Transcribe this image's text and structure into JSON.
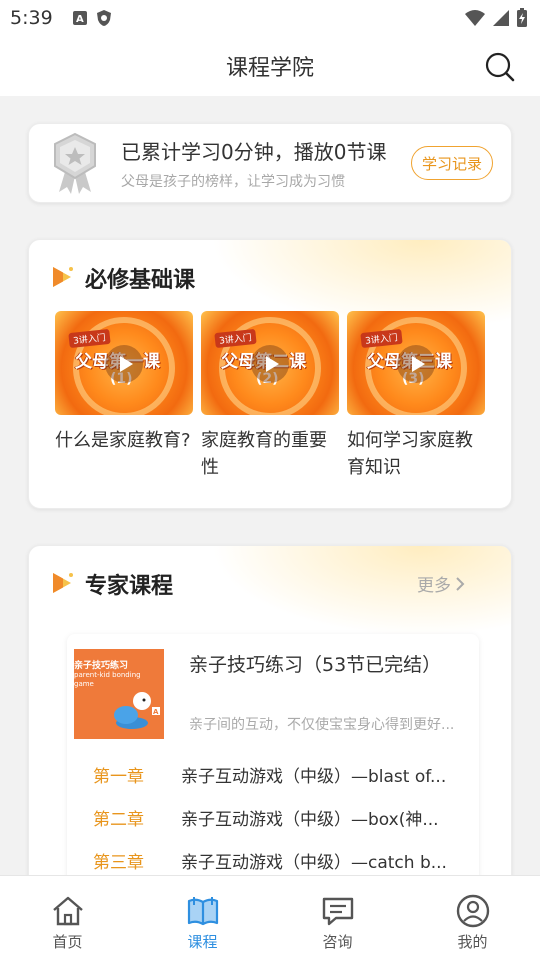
{
  "status_bar": {
    "time": "5:39"
  },
  "header": {
    "title": "课程学院"
  },
  "stats": {
    "main": "已累计学习0分钟，播放0节课",
    "sub": "父母是孩子的榜样，让学习成为习惯",
    "record_button": "学习记录"
  },
  "required": {
    "title": "必修基础课",
    "courses": [
      {
        "tag": "3讲入门",
        "thumb_title": "父母第一课",
        "thumb_num": "(1)",
        "name": "什么是家庭教育?"
      },
      {
        "tag": "3讲入门",
        "thumb_title": "父母第二课",
        "thumb_num": "(2)",
        "name": "家庭教育的重要性"
      },
      {
        "tag": "3讲入门",
        "thumb_title": "父母第三课",
        "thumb_num": "(3)",
        "name": "如何学习家庭教育知识"
      }
    ]
  },
  "expert": {
    "title": "专家课程",
    "more": "更多",
    "book": {
      "cover_title": "亲子技巧练习",
      "cover_sub": "parent-kid bonding",
      "cover_sub2": "game",
      "title": "亲子技巧练习（53节已完结）",
      "desc": "亲子间的互动，不仅使宝宝身心得到更好..."
    },
    "chapters": [
      {
        "label": "第一章",
        "text": "亲子互动游戏（中级）—blast of..."
      },
      {
        "label": "第二章",
        "text": "亲子互动游戏（中级）—box(神..."
      },
      {
        "label": "第三章",
        "text": "亲子互动游戏（中级）—catch b..."
      }
    ]
  },
  "nav": {
    "items": [
      {
        "label": "首页"
      },
      {
        "label": "课程"
      },
      {
        "label": "咨询"
      },
      {
        "label": "我的"
      }
    ]
  },
  "colors": {
    "accent": "#e8951c",
    "nav_active": "#2e8fe0"
  }
}
